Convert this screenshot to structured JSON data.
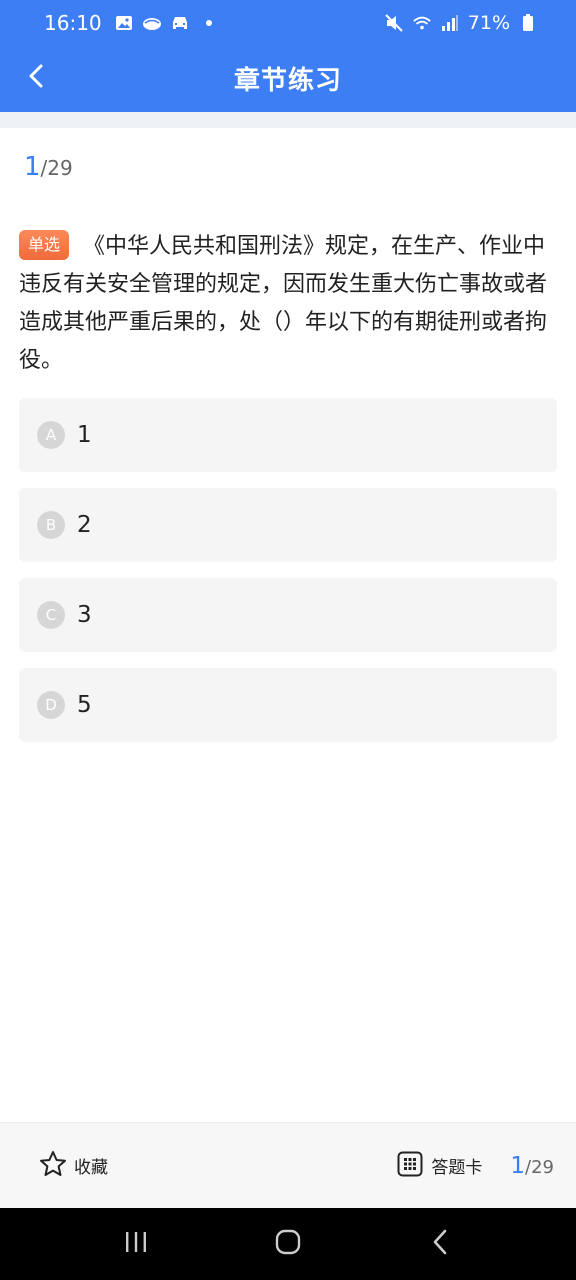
{
  "status_bar": {
    "time": "16:10",
    "battery": "71%",
    "left_icons": [
      "gallery-icon",
      "cloud-icon",
      "car-icon"
    ],
    "right_icons": [
      "mute-icon",
      "wifi-icon",
      "signal-icon",
      "battery-icon"
    ]
  },
  "header": {
    "title": "章节练习",
    "background": "#3d7ef5"
  },
  "progress": {
    "current": "1",
    "total": "/29"
  },
  "question": {
    "type_tag": "单选",
    "text": "《中华人民共和国刑法》规定，在生产、作业中违反有关安全管理的规定，因而发生重大伤亡事故或者造成其他严重后果的，处（）年以下的有期徒刑或者拘役。"
  },
  "options": [
    {
      "letter": "A",
      "text": "1"
    },
    {
      "letter": "B",
      "text": "2"
    },
    {
      "letter": "C",
      "text": "3"
    },
    {
      "letter": "D",
      "text": "5"
    }
  ],
  "bottom_bar": {
    "favorite_label": "收藏",
    "answer_card_label": "答题卡",
    "current": "1",
    "total": "/29"
  },
  "colors": {
    "accent": "#3d7ef5",
    "tag": "#f06a3a"
  }
}
